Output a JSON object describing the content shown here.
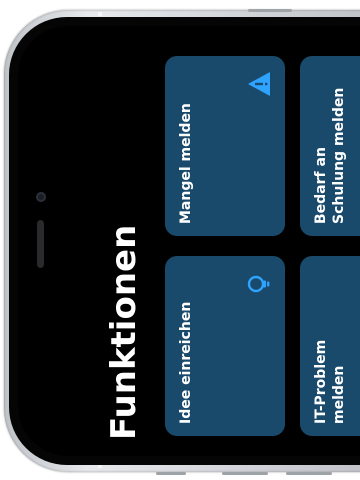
{
  "screen": {
    "title": "Funktionen"
  },
  "tiles": [
    {
      "label_lines": [
        "Mangel melden"
      ],
      "icon": "warning-icon"
    },
    {
      "label_lines": [
        "Idee einreichen"
      ],
      "icon": "lightbulb-icon"
    },
    {
      "label_lines": [
        "Bedarf an",
        "Schulung melden"
      ],
      "icon": ""
    },
    {
      "label_lines": [
        "IT-Problem",
        "melden"
      ],
      "icon": ""
    }
  ],
  "colors": {
    "tile_bg": "#1a4a6b",
    "icon_accent": "#2ea3ff",
    "screen_bg": "#000000",
    "text": "#ffffff"
  }
}
